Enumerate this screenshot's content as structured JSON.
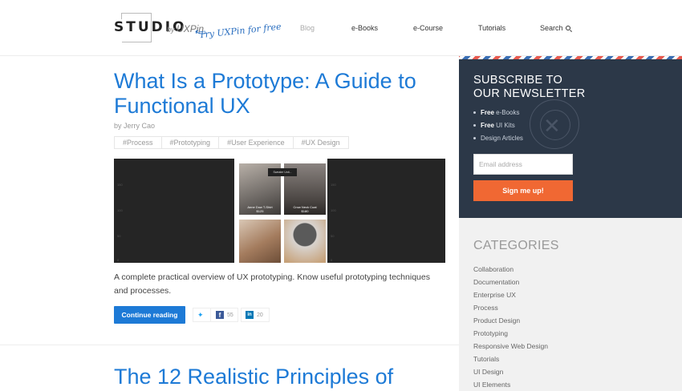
{
  "header": {
    "logo_text": "STUDIO",
    "logo_by": "by",
    "logo_brand": "UXPin",
    "try_free": "Try UXPin for free",
    "nav": [
      "Blog",
      "e-Books",
      "e-Course",
      "Tutorials",
      "Search"
    ],
    "colors": {
      "nav_muted": "#aaaaaa",
      "accent": "#1d7ad6"
    }
  },
  "post1": {
    "title": "What Is a Prototype: A Guide to Functional UX",
    "byline": "by Jerry Cao",
    "tags": [
      "#Process",
      "#Prototyping",
      "#User Experience",
      "#UX Design"
    ],
    "hero": {
      "left_ticks": [
        "150",
        "100",
        "50",
        "0"
      ],
      "right_ticks": [
        "150",
        "100",
        "50",
        "0"
      ],
      "tooltip": "Sweater Unit...",
      "products": [
        {
          "name": "Anne Dow T-Shirt",
          "price": "$125"
        },
        {
          "name": "Crow Neck Coat",
          "price": "$180"
        }
      ]
    },
    "excerpt": "A complete practical overview of UX prototyping. Know useful prototyping techniques and processes.",
    "continue_label": "Continue reading",
    "share": {
      "facebook_count": "55",
      "linkedin_count": "20"
    }
  },
  "post2": {
    "title": "The 12 Realistic Principles of"
  },
  "newsletter": {
    "title_line1": "SUBSCRIBE TO",
    "title_line2": "OUR NEWSLETTER",
    "items": [
      {
        "bold": "Free",
        "rest": " e-Books"
      },
      {
        "bold": "Free",
        "rest": " UI Kits"
      },
      {
        "bold": "",
        "rest": "Design Articles"
      }
    ],
    "email_placeholder": "Email address",
    "button_label": "Sign me up!",
    "colors": {
      "panel": "#2c3848",
      "button": "#f06833"
    }
  },
  "categories": {
    "title": "CATEGORIES",
    "items": [
      "Collaboration",
      "Documentation",
      "Enterprise UX",
      "Process",
      "Product Design",
      "Prototyping",
      "Responsive Web Design",
      "Tutorials",
      "UI Design",
      "UI Elements"
    ]
  }
}
